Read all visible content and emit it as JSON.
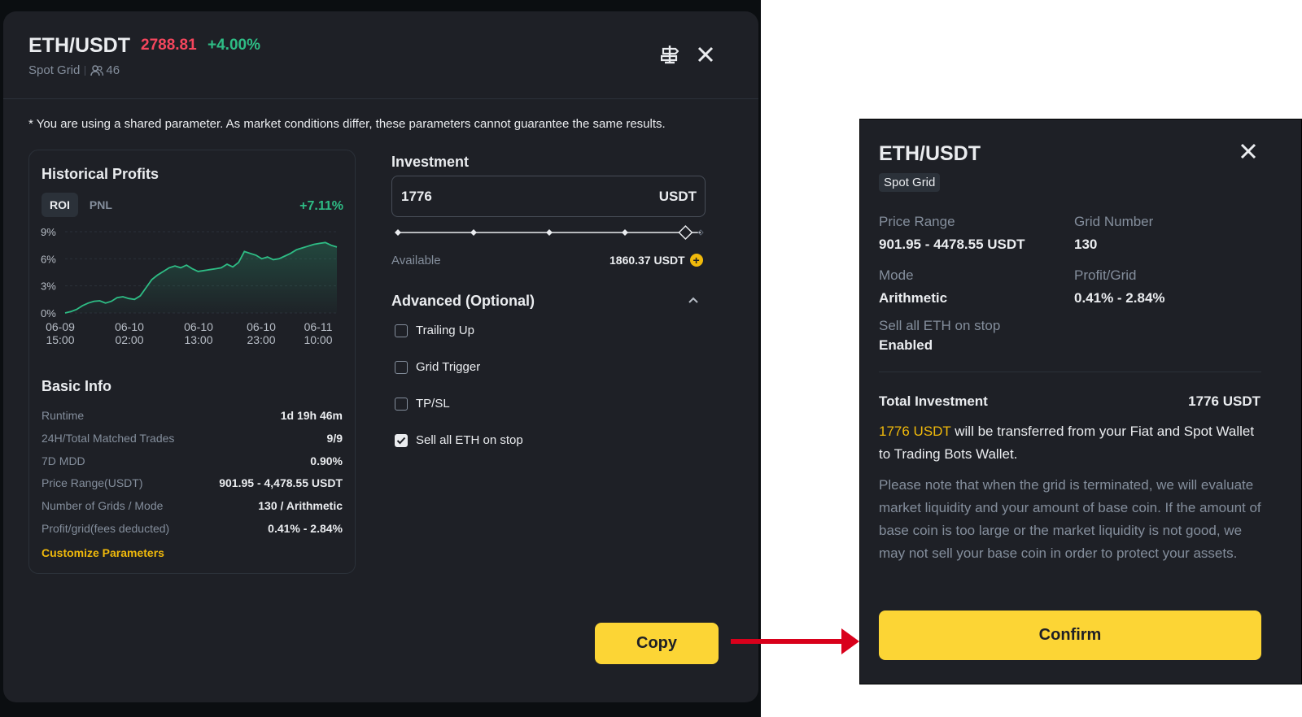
{
  "modal": {
    "pair": "ETH/USDT",
    "price": "2788.81",
    "change": "+4.00%",
    "strategy": "Spot Grid",
    "users": "46",
    "notice": "* You are using a shared parameter. As market conditions differ, these parameters cannot guarantee the same results."
  },
  "historical": {
    "title": "Historical Profits",
    "tabs": [
      "ROI",
      "PNL"
    ],
    "active_tab": "ROI",
    "roi_value": "+7.11%"
  },
  "chart_data": {
    "type": "area",
    "y_ticks": [
      "9%",
      "6%",
      "3%",
      "0%"
    ],
    "ylim": [
      0,
      9
    ],
    "x_ticks": [
      {
        "date": "06-09",
        "time": "15:00"
      },
      {
        "date": "06-10",
        "time": "02:00"
      },
      {
        "date": "06-10",
        "time": "13:00"
      },
      {
        "date": "06-10",
        "time": "23:00"
      },
      {
        "date": "06-11",
        "time": "10:00"
      }
    ],
    "values": [
      0.0,
      0.15,
      0.4,
      0.8,
      1.1,
      1.3,
      1.35,
      1.1,
      1.3,
      1.7,
      1.8,
      1.6,
      1.5,
      1.9,
      2.8,
      3.7,
      4.2,
      4.6,
      5.0,
      5.2,
      5.0,
      5.3,
      4.9,
      4.6,
      4.7,
      4.8,
      4.9,
      5.0,
      5.4,
      5.1,
      5.6,
      6.8,
      6.6,
      6.4,
      6.0,
      6.2,
      5.9,
      6.0,
      6.3,
      6.6,
      7.0,
      7.2,
      7.4,
      7.6,
      7.7,
      7.8,
      7.5,
      7.3
    ],
    "grid": true,
    "series_color": "#2ebd85"
  },
  "basic_info": {
    "title": "Basic Info",
    "rows": [
      {
        "k": "Runtime",
        "v": "1d 19h 46m"
      },
      {
        "k": "24H/Total Matched Trades",
        "v": "9/9"
      },
      {
        "k": "7D MDD",
        "v": "0.90%"
      },
      {
        "k": "Price Range(USDT)",
        "v": "901.95 - 4,478.55 USDT"
      },
      {
        "k": "Number of Grids / Mode",
        "v": "130 / Arithmetic"
      },
      {
        "k": "Profit/grid(fees deducted)",
        "v": "0.41% - 2.84%"
      }
    ],
    "customize": "Customize Parameters"
  },
  "investment": {
    "title": "Investment",
    "value": "1776",
    "unit": "USDT",
    "slider_fraction": 0.95,
    "available_label": "Available",
    "available_value": "1860.37 USDT"
  },
  "advanced": {
    "title": "Advanced (Optional)",
    "options": [
      {
        "label": "Trailing Up",
        "checked": false
      },
      {
        "label": "Grid Trigger",
        "checked": false
      },
      {
        "label": "TP/SL",
        "checked": false
      },
      {
        "label": "Sell all ETH on stop",
        "checked": true
      }
    ]
  },
  "copy_label": "Copy",
  "confirm_panel": {
    "pair": "ETH/USDT",
    "badge": "Spot Grid",
    "price_range_k": "Price Range",
    "price_range_v": "901.95 - 4478.55 USDT",
    "grid_number_k": "Grid Number",
    "grid_number_v": "130",
    "mode_k": "Mode",
    "mode_v": "Arithmetic",
    "profit_grid_k": "Profit/Grid",
    "profit_grid_v": "0.41% - 2.84%",
    "sell_k": "Sell all ETH on stop",
    "sell_v": "Enabled",
    "total_k": "Total Investment",
    "total_v": "1776 USDT",
    "transfer_amount": "1776 USDT",
    "transfer_text": " will be transferred from your Fiat and Spot Wallet to Trading Bots Wallet.",
    "note": "Please note that when the grid is terminated, we will evaluate market liquidity and your amount of base coin. If the amount of base coin is too large or the market liquidity is not good, we may not sell your base coin in order to protect your assets.",
    "confirm_label": "Confirm"
  },
  "colors": {
    "accent": "#fcd535",
    "up": "#2ebd85",
    "down": "#f6465d",
    "arrow": "#d9001b"
  }
}
